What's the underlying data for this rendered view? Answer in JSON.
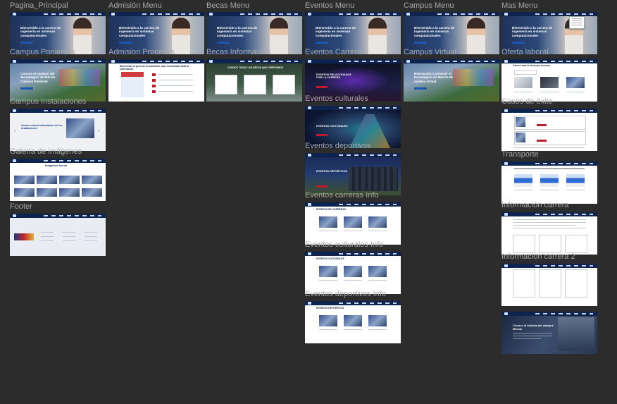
{
  "canvas": {
    "background": "#2c2c2c",
    "label_color": "#a9a9a9"
  },
  "frames": [
    {
      "id": "pagina_principal",
      "label": "Pagina_Principal",
      "headline": "Bienvenido a la carrera de ingeniería en sistemas computacionales"
    },
    {
      "id": "admision_menu",
      "label": "Admisión Menu",
      "headline": "Bienvenido a la carrera de ingeniería en sistemas computacionales"
    },
    {
      "id": "becas_menu",
      "label": "Becas Menu",
      "headline": "Bienvenido a la carrera de ingeniería en sistemas computacionales"
    },
    {
      "id": "eventos_menu",
      "label": "Eventos Menu",
      "headline": "Bienvenido a la carrera de ingeniería en sistemas computacionales"
    },
    {
      "id": "campus_menu",
      "label": "Campus Menu",
      "headline": "Bienvenido a la carrera de ingeniería en sistemas computacionales"
    },
    {
      "id": "mas_menu",
      "label": "Mas Menu",
      "headline": "Bienvenido a la carrera de ingeniería en sistemas computacionales"
    },
    {
      "id": "campus_ponientes",
      "label": "Campus Ponientes",
      "headline": "Conoce el campus del Tecnológico de Mérida Campus Poniente"
    },
    {
      "id": "admision_procesos",
      "label": "Admision Procesos",
      "headline": "Bienvenido al proceso de admisión, aquí encontrarás toda la información"
    },
    {
      "id": "becas_informacion",
      "label": "Becas Información",
      "headline": "CONOCE TODAS LAS BECAS QUE OFRECEMOS"
    },
    {
      "id": "eventos_carrera",
      "label": "Eventos Carrera",
      "headline": "EVENTOS RELACIONADOS POR LA CARRERA"
    },
    {
      "id": "campus_virtual",
      "label": "Campus Virtual",
      "headline": "Bienvenido a conocer el tecnológico de Mérida de manera virtual"
    },
    {
      "id": "oferta_laboral",
      "label": "Oferta laboral",
      "headline": "Conoce toda la oferta que tenemos"
    },
    {
      "id": "campus_instalaciones",
      "label": "Campus Instalaciones",
      "headline": "Conoce más la información de tus instalaciones"
    },
    {
      "id": "eventos_culturales",
      "label": "Eventos culturales",
      "headline": "EVENTOS CULTURALES"
    },
    {
      "id": "casos_de_exito",
      "label": "Casos de éxito",
      "headline": ""
    },
    {
      "id": "galeria_de_imagenes",
      "label": "Galería de imágenes",
      "headline": "Imágenes tecnm"
    },
    {
      "id": "eventos_deportivos",
      "label": "Eventos deportivos",
      "headline": "EVENTOS DEPORTIVOS"
    },
    {
      "id": "transporte",
      "label": "Transporte",
      "headline": ""
    },
    {
      "id": "eventos_carreras_info",
      "label": "Eventos carreras Info",
      "headline": "EVENTOS DE CARRERAS"
    },
    {
      "id": "informacion_carrera",
      "label": "Información carrera",
      "headline": ""
    },
    {
      "id": "footer",
      "label": "Footer",
      "headline": ""
    },
    {
      "id": "eventos_culturales_info",
      "label": "Eventos culturales Info",
      "headline": "EVENTOS CULTURALES"
    },
    {
      "id": "informacion_carrera_2",
      "label": "Información carrera 2",
      "headline": ""
    },
    {
      "id": "eventos_deportivos_info",
      "label": "Eventos deportivos Info",
      "headline": "EVENTOS DEPORTIVOS"
    },
    {
      "id": "carrera_extra",
      "label": "",
      "headline": "Conoce la historia del campus Mérida"
    }
  ]
}
